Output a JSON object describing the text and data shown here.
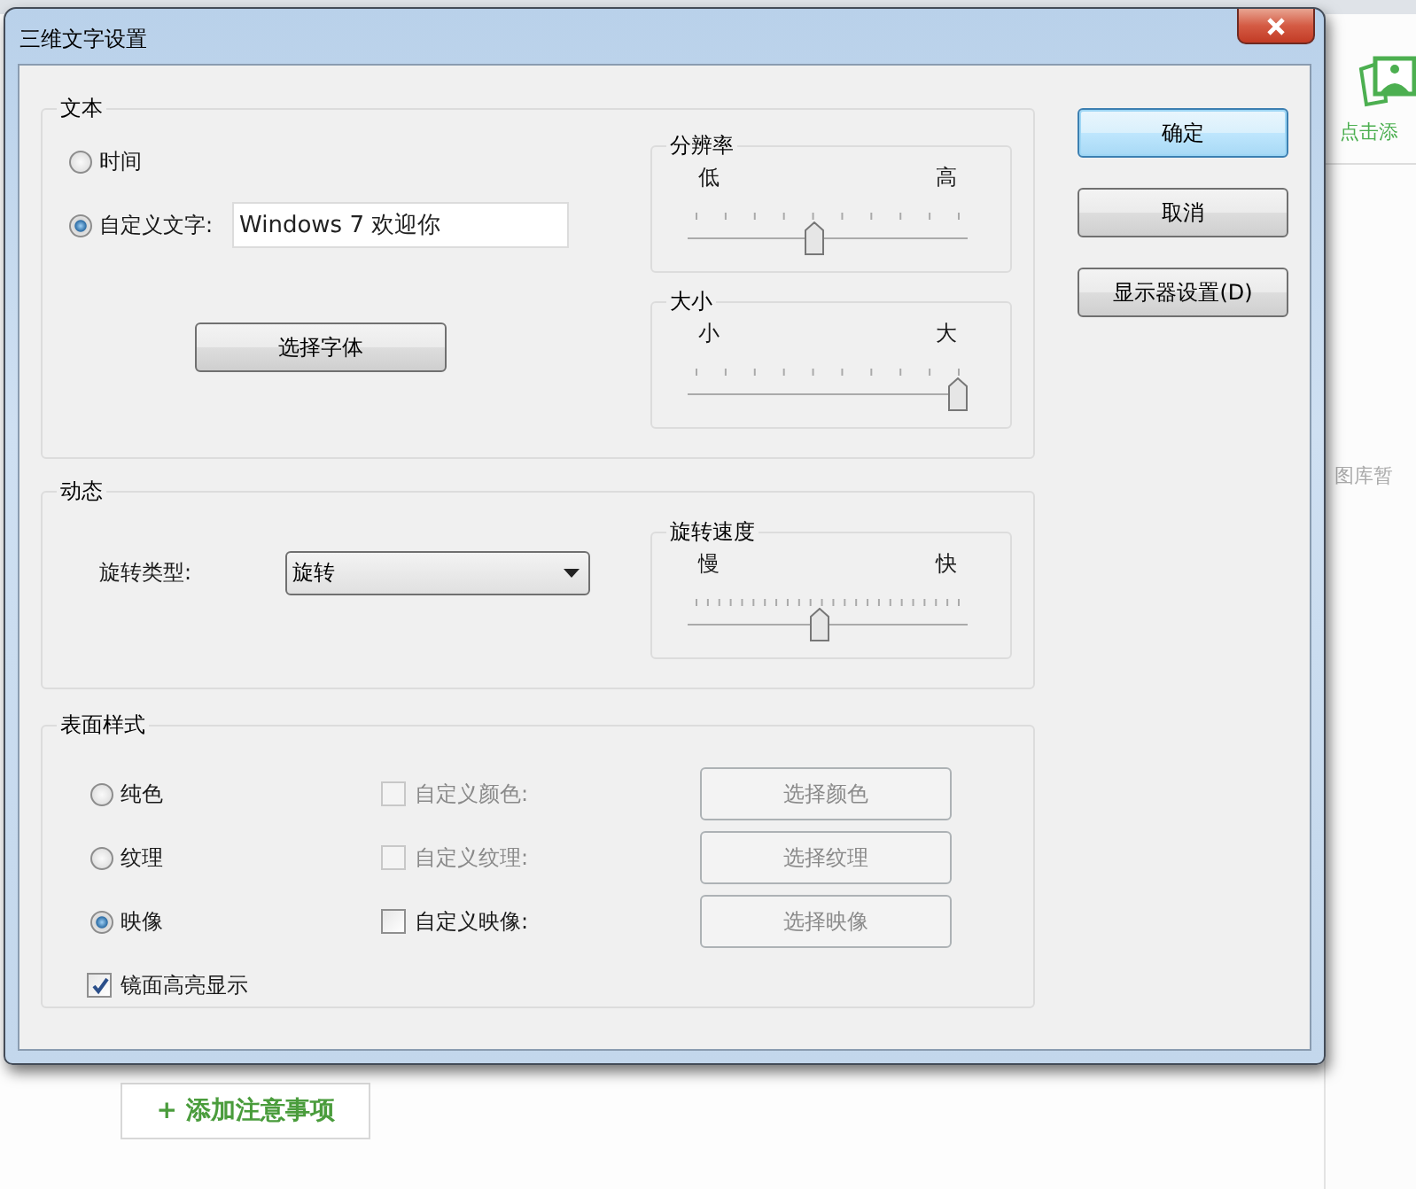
{
  "window": {
    "title": "三维文字设置"
  },
  "text_group": {
    "label": "文本",
    "options": [
      {
        "label": "时间",
        "selected": false
      },
      {
        "label": "自定义文字:",
        "selected": true
      }
    ],
    "custom_text": "Windows 7 欢迎你",
    "font_button": "选择字体",
    "sliders": [
      {
        "label": "分辨率",
        "min_label": "低",
        "max_label": "高",
        "level": 0.45
      },
      {
        "label": "大小",
        "min_label": "小",
        "max_label": "大",
        "level": 1.0
      }
    ]
  },
  "motion_group": {
    "label": "动态",
    "rotation_type_label": "旋转类型:",
    "rotation_type": "旋转",
    "speed": {
      "label": "旋转速度",
      "min_label": "慢",
      "max_label": "快",
      "level": 0.47
    }
  },
  "surface_group": {
    "label": "表面样式",
    "rows": [
      {
        "label": "纯色",
        "selected": false,
        "custom_label": "自定义颜色:",
        "custom_checked": false,
        "custom_disabled": true,
        "button": "选择颜色",
        "button_disabled": true
      },
      {
        "label": "纹理",
        "selected": false,
        "custom_label": "自定义纹理:",
        "custom_checked": false,
        "custom_disabled": true,
        "button": "选择纹理",
        "button_disabled": true
      },
      {
        "label": "映像",
        "selected": true,
        "custom_label": "自定义映像:",
        "custom_checked": false,
        "custom_disabled": false,
        "button": "选择映像",
        "button_disabled": true
      }
    ],
    "specular": {
      "label": "镜面高亮显示",
      "checked": true
    }
  },
  "buttons": [
    {
      "label": "确定",
      "default": true
    },
    {
      "label": "取消",
      "default": false
    },
    {
      "label": "显示器设置(D)",
      "default": false
    }
  ],
  "background_page": {
    "add_image_label": "点击添",
    "gallery_note": "图库暂",
    "add_note_button": "+ 添加注意事项"
  }
}
